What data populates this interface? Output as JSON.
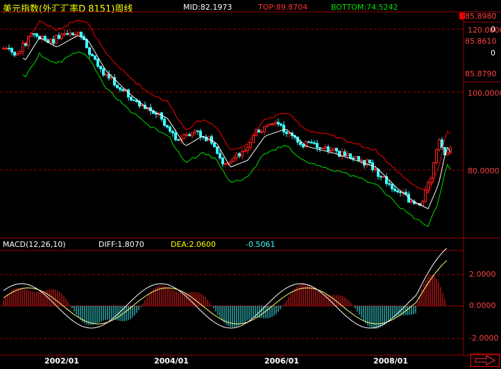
{
  "header": {
    "title": "美元指数(外汇汇率D 8151)周线",
    "mid": "MID:82.1973",
    "top": "TOP:89.8704",
    "bottom": "BOTTOM:74.5242"
  },
  "right_panel": {
    "values": [
      "85.8980",
      "0",
      "85.8610",
      "0",
      "85.8790"
    ]
  },
  "price_axis": {
    "ticks": [
      "120.0000",
      "100.0000",
      "80.0000"
    ]
  },
  "macd": {
    "title": "MACD(12,26,10)",
    "diff": "DIFF:1.8070",
    "dea": "DEA:2.0600",
    "macd": "-0.5061",
    "ticks": [
      "2.0000",
      "0.0000",
      "-2.0000"
    ]
  },
  "x_axis": {
    "labels": [
      "2002/01",
      "2004/01",
      "2006/01",
      "2008/01"
    ]
  },
  "colors": {
    "up": "#ff2020",
    "down": "#40ffff",
    "upper_band": "#ff0000",
    "mid_band": "#ffffff",
    "lower_band": "#00e000",
    "dea_line": "#ffff80",
    "diff_line": "#ffffff",
    "grid": "#a00000"
  },
  "icons": {
    "scroll_right": "right-arrow-icon"
  }
}
